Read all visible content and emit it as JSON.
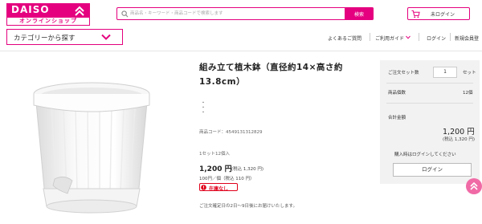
{
  "header": {
    "logo_text": "DAISO",
    "logo_sub": "オンラインショップ",
    "search_placeholder": "商品名・キーワード・商品コードで検索します",
    "search_button": "検索",
    "cart_login": "未ログイン",
    "category_button": "カテゴリーから探す",
    "nav": {
      "faq": "よくあるご質問",
      "guide": "ご利用ガイド",
      "login": "ログイン",
      "register": "新規会員登"
    }
  },
  "product": {
    "title": "組み立て植木鉢（直径約14×高さ約13.8cm）",
    "dots": "・\n・\n・",
    "code": "商品コード：4549131312829",
    "set_info": "1セット12個入",
    "price": "1,200 円",
    "price_tax": "(税込 1,320 円)",
    "unit_price": "100円／個（税込 110 円）",
    "stock": "在庫なし",
    "delivery": "ご注文確定日の2日〜9日後にお届けいたします。"
  },
  "order": {
    "set_count_label": "ご注文セット数",
    "qty": "1",
    "qty_unit": "セット",
    "item_count_label": "商品個数",
    "item_count": "12個",
    "total_label": "合計金額",
    "total_price": "1,200 円",
    "total_tax": "(税込 1,320 円)",
    "login_note": "購入時はログインしてください",
    "login_button": "ログイン"
  },
  "colors": {
    "brand": "#e4007f",
    "out_of_stock": "#e0001b",
    "order_box_bg": "#f2f2f2"
  },
  "icons": [
    "logo-chevron-icon",
    "search-icon",
    "cart-icon",
    "chevron-down-icon",
    "warning-icon",
    "arrow-up-icon"
  ]
}
